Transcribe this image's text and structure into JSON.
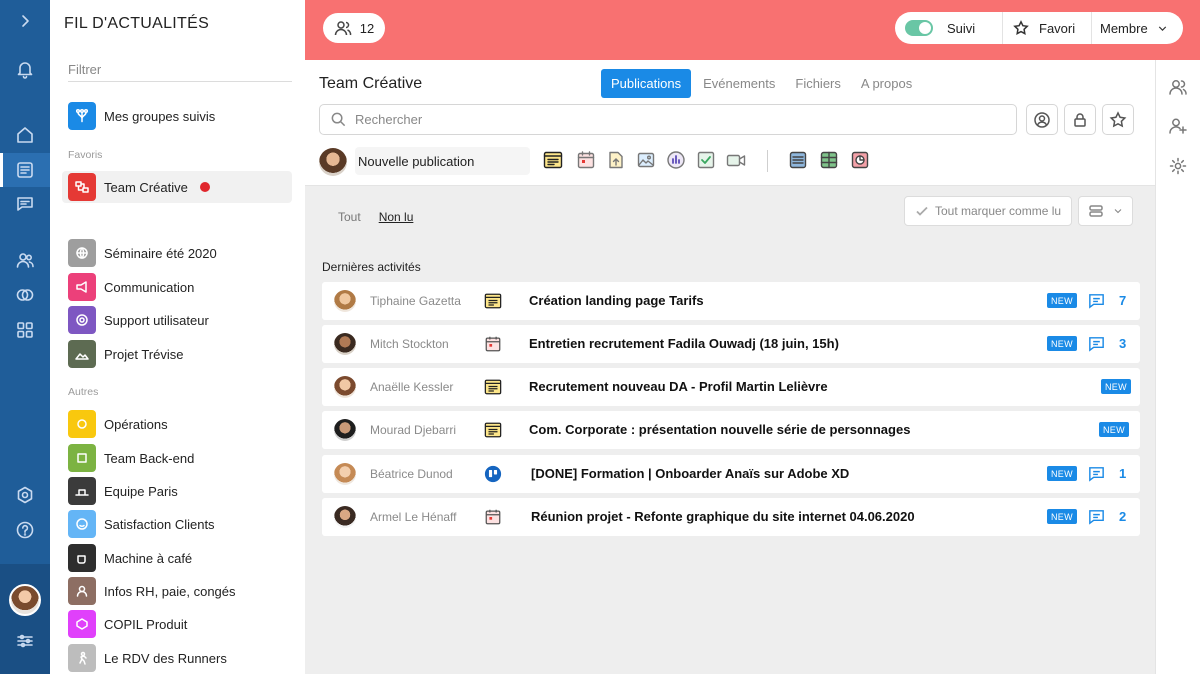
{
  "rail": {
    "icons": [
      "chevron-right-icon",
      "bell-icon",
      "home-icon",
      "feed-icon",
      "chat-icon",
      "people-icon",
      "rings-icon",
      "apps-icon",
      "settings-icon",
      "help-icon",
      "sliders-icon"
    ]
  },
  "sidebar": {
    "title": "FIL D'ACTUALITÉS",
    "filter_placeholder": "Filtrer",
    "followed_label": "Mes groupes suivis",
    "favorites_label": "Favoris",
    "others_label": "Autres",
    "favorites": [
      {
        "label": "Team Créative",
        "color": "#e53935",
        "unread": true
      }
    ],
    "groups": [
      {
        "label": "Séminaire été 2020",
        "color": "#9e9e9e"
      },
      {
        "label": "Communication",
        "color": "#ec407a"
      },
      {
        "label": "Support utilisateur",
        "color": "#7e57c2"
      },
      {
        "label": "Projet Trévise",
        "color": "#5d6b52"
      }
    ],
    "others": [
      {
        "label": "Opérations",
        "color": "#f9c80e"
      },
      {
        "label": "Team Back-end",
        "color": "#7cb342"
      },
      {
        "label": "Equipe Paris",
        "color": "#3b3b3b"
      },
      {
        "label": "Satisfaction Clients",
        "color": "#64b5f6"
      },
      {
        "label": "Machine à café",
        "color": "#2e2e2e"
      },
      {
        "label": "Infos RH, paie, congés",
        "color": "#8d6e63"
      },
      {
        "label": "COPIL Produit",
        "color": "#e040fb"
      },
      {
        "label": "Le RDV des Runners",
        "color": "#bdbdbd"
      }
    ]
  },
  "header": {
    "member_count": "12",
    "follow_label": "Suivi",
    "favorite_label": "Favori",
    "member_label": "Membre"
  },
  "panel": {
    "title": "Team Créative",
    "tabs": [
      "Publications",
      "Evénements",
      "Fichiers",
      "A propos"
    ],
    "active_tab": "Publications",
    "search_placeholder": "Rechercher",
    "new_post_label": "Nouvelle publication"
  },
  "feed": {
    "filters": [
      "Tout",
      "Non lu"
    ],
    "active_filter": "Non lu",
    "mark_all_label": "Tout marquer comme lu",
    "recent_label": "Dernières activités",
    "new_badge": "NEW",
    "items": [
      {
        "author": "Tiphaine Gazetta",
        "type": "article",
        "title": "Création landing page Tarifs",
        "comments": "7"
      },
      {
        "author": "Mitch Stockton",
        "type": "event",
        "title": "Entretien recrutement Fadila Ouwadj (18 juin, 15h)",
        "comments": "3"
      },
      {
        "author": "Anaëlle Kessler",
        "type": "article",
        "title": "Recrutement nouveau DA - Profil Martin Lelièvre",
        "comments": ""
      },
      {
        "author": "Mourad Djebarri",
        "type": "article",
        "title": "Com. Corporate : présentation nouvelle série de personnages",
        "comments": ""
      },
      {
        "author": "Béatrice Dunod",
        "type": "trello",
        "title": "[DONE] Formation | Onboarder Anaïs sur Adobe XD",
        "comments": "1"
      },
      {
        "author": "Armel Le Hénaff",
        "type": "event",
        "title": "Réunion projet - Refonte graphique du site internet 04.06.2020",
        "comments": "2"
      }
    ]
  },
  "colors": {
    "band": "#f87171",
    "rail": "#1f5d99",
    "accent": "#1a8ae6",
    "toggle": "#69c6a5"
  }
}
